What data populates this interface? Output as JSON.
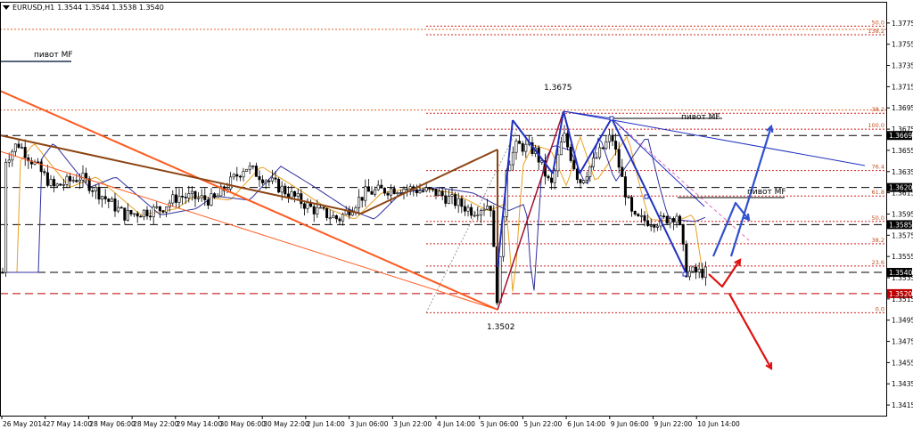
{
  "header": {
    "symbol": "EURUSD,H1",
    "ohlc": "1.3544 1.3544 1.3538 1.3540"
  },
  "chart_data": {
    "type": "candlestick",
    "symbol": "EURUSD",
    "timeframe": "H1",
    "ylim": [
      1.3405,
      1.3795
    ],
    "price_ticks": [
      "1.3775",
      "1.3755",
      "1.3735",
      "1.3715",
      "1.3695",
      "1.3675",
      "1.3655",
      "1.3635",
      "1.3615",
      "1.3595",
      "1.3575",
      "1.3555",
      "1.3535",
      "1.3515",
      "1.3495",
      "1.3475",
      "1.3455",
      "1.3435",
      "1.3415"
    ],
    "time_labels": [
      "26 May 2014",
      "27 May 14:00",
      "28 May 06:00",
      "28 May 22:00",
      "29 May 14:00",
      "30 May 06:00",
      "30 May 22:00",
      "2 Jun 14:00",
      "3 Jun 06:00",
      "3 Jun 22:00",
      "4 Jun 14:00",
      "5 Jun 06:00",
      "5 Jun 22:00",
      "6 Jun 14:00",
      "9 Jun 06:00",
      "9 Jun 22:00",
      "10 Jun 14:00"
    ],
    "level_boxes": [
      {
        "label": "1.3669",
        "price": 1.3669,
        "style": "dark"
      },
      {
        "label": "1.3620",
        "price": 1.362,
        "style": "dark"
      },
      {
        "label": "1.3585",
        "price": 1.3585,
        "style": "dark"
      },
      {
        "label": "1.3540",
        "price": 1.354,
        "style": "dark"
      },
      {
        "label": "1.3520",
        "price": 1.352,
        "style": "red"
      }
    ],
    "fib_upper": [
      {
        "label": "50.0",
        "price": 1.3772
      },
      {
        "label": "138.2",
        "price": 1.3764
      },
      {
        "label": "38.2",
        "price": 1.369
      }
    ],
    "fib_main": [
      {
        "label": "100.0",
        "price": 1.3675
      },
      {
        "label": "76.4",
        "price": 1.3636
      },
      {
        "label": "61.8",
        "price": 1.3612
      },
      {
        "label": "50.0",
        "price": 1.3588
      },
      {
        "label": "38.2",
        "price": 1.3567
      },
      {
        "label": "23.6",
        "price": 1.3546
      },
      {
        "label": "0.0",
        "price": 1.3502
      }
    ],
    "annotations": {
      "high": "1.3675",
      "low": "1.3502",
      "pivot": "пивот MF"
    },
    "grid": false
  }
}
